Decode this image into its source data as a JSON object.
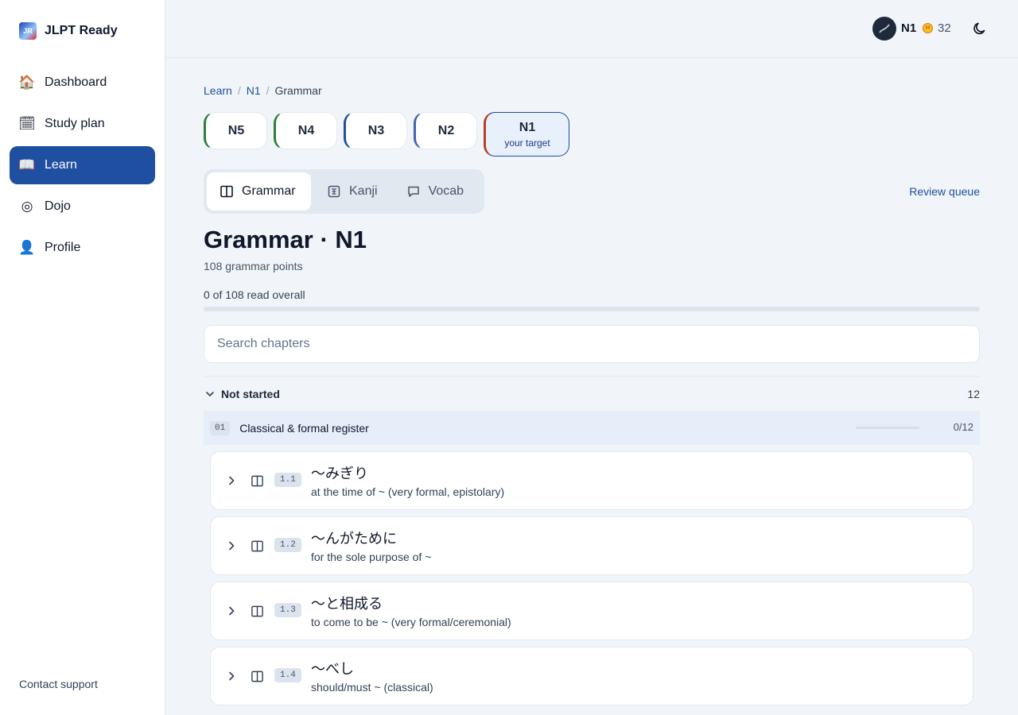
{
  "brand": {
    "name": "JLPT Ready"
  },
  "sidebar": {
    "items": [
      {
        "label": "Dashboard",
        "icon": "house-icon",
        "glyph": "🏠"
      },
      {
        "label": "Study plan",
        "icon": "calendar-icon",
        "glyph": "🗓"
      },
      {
        "label": "Learn",
        "icon": "book-icon",
        "glyph": "📖"
      },
      {
        "label": "Dojo",
        "icon": "target-icon",
        "glyph": "◎"
      },
      {
        "label": "Profile",
        "icon": "user-icon",
        "glyph": "👤"
      }
    ],
    "active": "Learn",
    "support": "Contact support"
  },
  "topbar": {
    "level": "N1",
    "coins": "32"
  },
  "breadcrumb": {
    "root": "Learn",
    "level": "N1",
    "current": "Grammar",
    "sep": "/"
  },
  "levels": [
    {
      "label": "N5"
    },
    {
      "label": "N4"
    },
    {
      "label": "N3"
    },
    {
      "label": "N2"
    },
    {
      "label": "N1",
      "sub": "your target"
    }
  ],
  "tabs": [
    {
      "label": "Grammar"
    },
    {
      "label": "Kanji"
    },
    {
      "label": "Vocab"
    }
  ],
  "review_label": "Review queue",
  "page": {
    "title": "Grammar · N1",
    "subtitle": "108 grammar points",
    "overall": "0 of 108 read overall",
    "progress": 0
  },
  "search": {
    "placeholder": "Search chapters",
    "value": ""
  },
  "group": {
    "label": "Not started",
    "count": "12"
  },
  "chapter": {
    "num": "01",
    "name": "Classical & formal register",
    "count": "0/12",
    "progress": 0
  },
  "items": [
    {
      "num": "1.1",
      "jp": "〜みぎり",
      "en": "at the time of ~ (very formal, epistolary)"
    },
    {
      "num": "1.2",
      "jp": "〜んがために",
      "en": "for the sole purpose of ~"
    },
    {
      "num": "1.3",
      "jp": "〜と相成る",
      "en": "to come to be ~ (very formal/ceremonial)"
    },
    {
      "num": "1.4",
      "jp": "〜べし",
      "en": "should/must ~ (classical)"
    }
  ],
  "colors": {
    "accent": "#1e4fa0",
    "n1_border": "#b5402a",
    "n5_border": "#2f7d3b"
  }
}
